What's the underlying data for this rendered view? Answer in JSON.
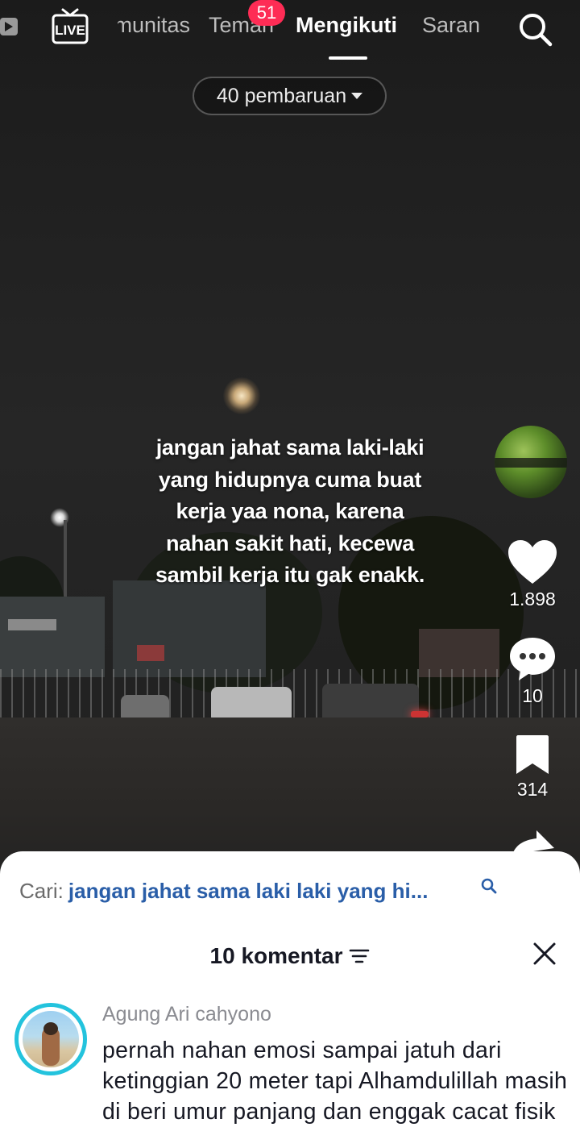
{
  "top_nav": {
    "tabs": [
      {
        "label": "Komunitas"
      },
      {
        "label": "Teman",
        "badge": "51"
      },
      {
        "label": "Mengikuti",
        "active": true
      },
      {
        "label": "Saran"
      }
    ],
    "live_icon": "live-tv-icon",
    "search_icon": "search-icon"
  },
  "updates": {
    "label": "40 pembaruan"
  },
  "video": {
    "caption": "jangan jahat sama laki-laki yang hidupnya cuma buat kerja yaa nona, karena nahan sakit hati, kecewa sambil kerja itu gak enakk."
  },
  "actions": {
    "like_count": "1.898",
    "comment_count": "10",
    "bookmark_count": "314"
  },
  "comments_sheet": {
    "search_prefix": "Cari:",
    "search_query": "jangan jahat sama laki laki yang hi...",
    "title": "10 komentar",
    "comments": [
      {
        "author": "Agung Ari cahyono",
        "text": "pernah nahan emosi sampai jatuh dari ketinggian 20 meter tapi Alhamdulillah masih di beri umur panjang dan enggak cacat fisik"
      }
    ]
  },
  "colors": {
    "accent_red": "#fe2c55",
    "link_blue": "#2a5ea8",
    "story_ring": "#23c3dd"
  }
}
